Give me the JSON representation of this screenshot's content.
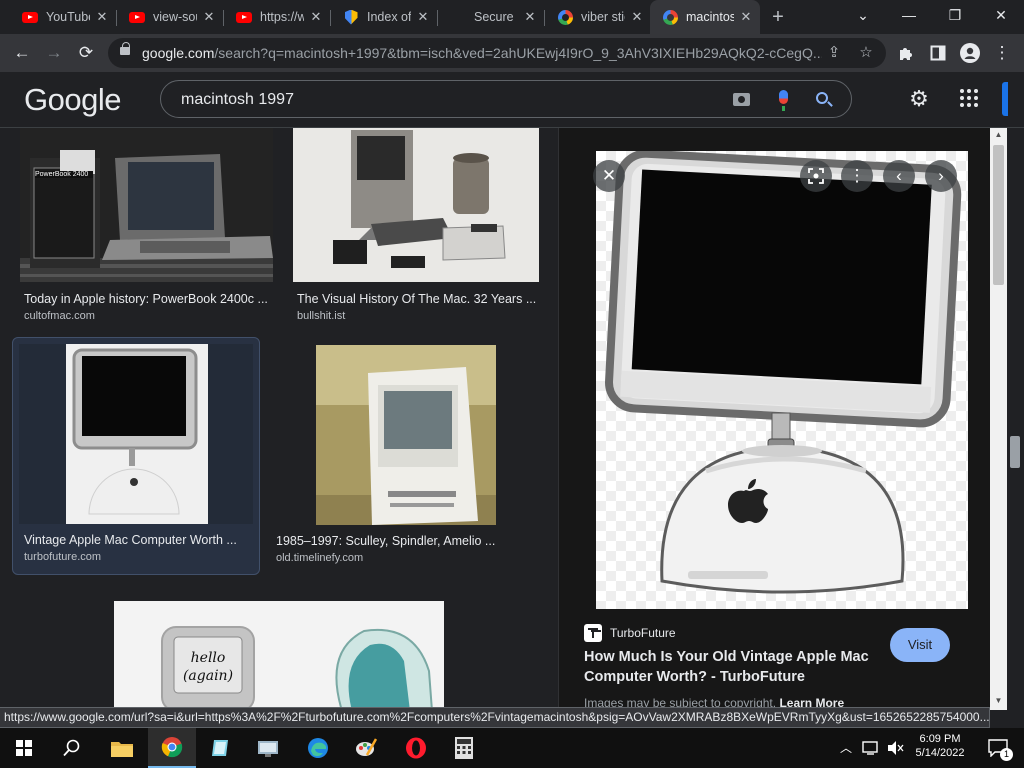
{
  "browser": {
    "tabs": [
      {
        "title": "YouTube",
        "favicon": "youtube-icon",
        "active": false
      },
      {
        "title": "view-source",
        "favicon": "youtube-icon",
        "active": false
      },
      {
        "title": "https://www.",
        "favicon": "youtube-icon",
        "active": false
      },
      {
        "title": "Index of",
        "favicon": "shield-icon",
        "active": false
      },
      {
        "title": "Secure",
        "favicon": "blank-icon",
        "active": false
      },
      {
        "title": "viber stickers",
        "favicon": "google-icon",
        "active": false
      },
      {
        "title": "macintosh",
        "favicon": "google-icon",
        "active": true
      }
    ],
    "new_tab": "+",
    "window_controls": {
      "tab_search": "⌄",
      "minimize": "—",
      "maximize": "❐",
      "close": "✕"
    },
    "nav": {
      "back": "←",
      "forward": "→",
      "reload": "⟳"
    },
    "url_host": "google.com",
    "url_rest": "/search?q=macintosh+1997&tbm=isch&ved=2ahUKEwj4I9rO_9_3AhV3IXIEHb29AQkQ2-cCegQ...",
    "toolbar_icons": {
      "share": "⇪",
      "bookmark": "☆",
      "extensions": "puzzle-icon",
      "sidepanel": "sidepanel-icon",
      "profile": "profile-icon",
      "menu": "⋮"
    }
  },
  "google": {
    "logo": "Google",
    "query": "macintosh 1997",
    "colors": {
      "accent": "#8ab4f8",
      "selected_card": "#283142"
    }
  },
  "results": [
    {
      "title": "Today in Apple history: PowerBook 2400c ...",
      "source": "cultofmac.com",
      "image": "powerbook-laptop-photo",
      "photo_text": "PowerBook 2400",
      "selected": false
    },
    {
      "title": "The Visual History Of The Mac. 32 Years ...",
      "source": "bullshit.ist",
      "image": "twentieth-anniversary-mac-photo",
      "selected": false
    },
    {
      "title": "Vintage Apple Mac Computer Worth ...",
      "source": "turbofuture.com",
      "image": "imac-g4-photo",
      "selected": true
    },
    {
      "title": "1985–1997: Sculley, Spindler, Amelio ...",
      "source": "old.timelinefy.com",
      "image": "macintosh-classic-photo",
      "selected": false
    },
    {
      "title": "",
      "source": "",
      "image": "imac-hello-again-photo",
      "photo_text": "hello (again)",
      "selected": false
    }
  ],
  "preview": {
    "image": "imac-g4-large-photo",
    "source_name": "TurboFuture",
    "title": "How Much Is Your Old Vintage Apple Mac Computer Worth? - TurboFuture",
    "visit_label": "Visit",
    "copyright_text": "Images may be subject to copyright.",
    "learn_more": "Learn More",
    "controls": {
      "close": "✕",
      "lens": "lens-icon",
      "more": "⋮",
      "prev": "‹",
      "next": "›"
    }
  },
  "status_url": "https://www.google.com/url?sa=i&url=https%3A%2F%2Fturbofuture.com%2Fcomputers%2Fvintagemacintosh&psig=AOvVaw2XMRABz8BXeWpEVRmTyyXg&ust=1652652285754000...",
  "taskbar": {
    "apps": [
      "windows-start-icon",
      "search-icon",
      "file-explorer-icon",
      "chrome-icon",
      "notepad-icon",
      "control-panel-icon",
      "edge-icon",
      "paint-icon",
      "opera-icon",
      "calculator-icon"
    ],
    "time": "6:09 PM",
    "date": "5/14/2022",
    "notification_count": "1"
  }
}
